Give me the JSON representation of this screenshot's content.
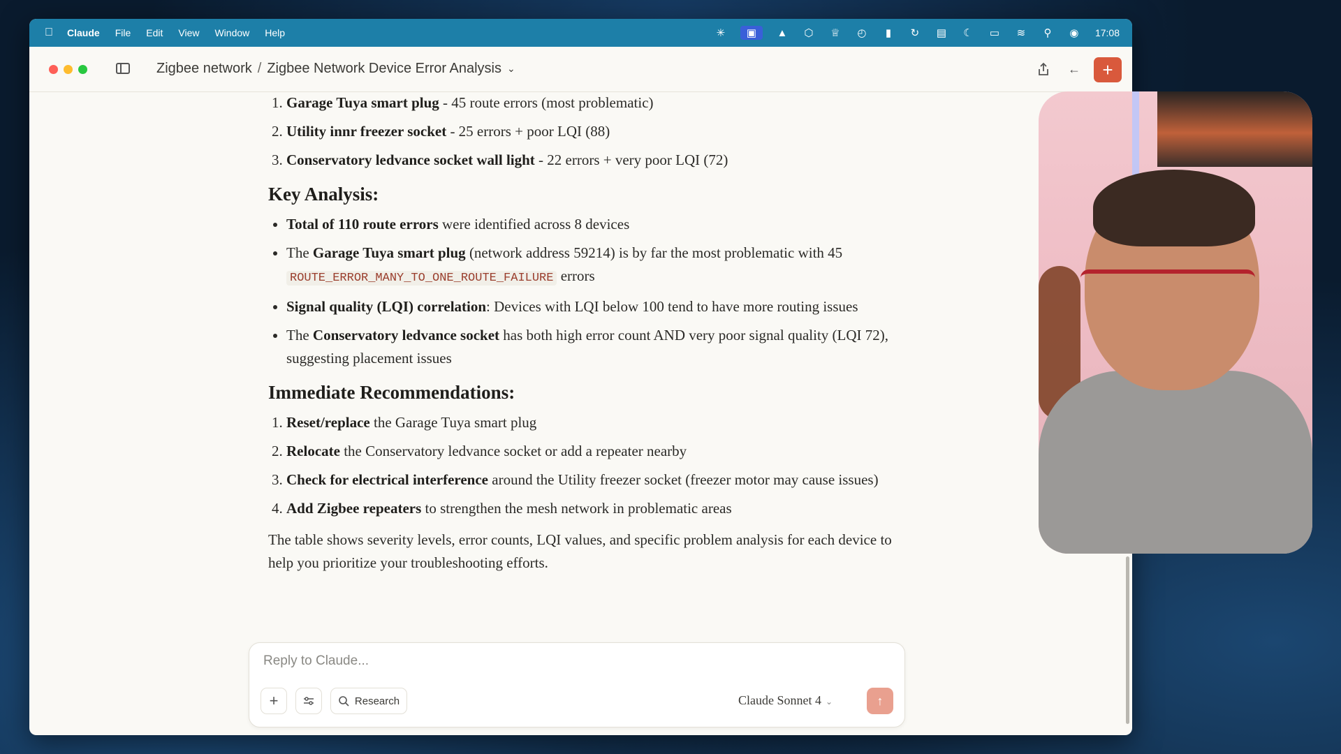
{
  "menubar": {
    "app_name": "Claude",
    "items": [
      "File",
      "Edit",
      "View",
      "Window",
      "Help"
    ],
    "clock": "17:08"
  },
  "titlebar": {
    "breadcrumb_parent": "Zigbee network",
    "breadcrumb_separator": "/",
    "breadcrumb_current": "Zigbee Network Device Error Analysis"
  },
  "content": {
    "top_list": [
      {
        "bold": "Garage Tuya smart plug",
        "rest": " - 45 route errors (most problematic)"
      },
      {
        "bold": "Utility innr freezer socket",
        "rest": " - 25 errors + poor LQI (88)"
      },
      {
        "bold": "Conservatory ledvance socket wall light",
        "rest": " - 22 errors + very poor LQI (72)"
      }
    ],
    "key_analysis_heading": "Key Analysis:",
    "key_analysis": {
      "b1_bold": "Total of 110 route errors",
      "b1_rest": " were identified across 8 devices",
      "b2_pre": "The ",
      "b2_bold": "Garage Tuya smart plug",
      "b2_mid": " (network address 59214) is by far the most problematic with 45 ",
      "b2_code": "ROUTE_ERROR_MANY_TO_ONE_ROUTE_FAILURE",
      "b2_post": " errors",
      "b3_bold": "Signal quality (LQI) correlation",
      "b3_rest": ": Devices with LQI below 100 tend to have more routing issues",
      "b4_pre": "The ",
      "b4_bold": "Conservatory ledvance socket",
      "b4_rest": " has both high error count AND very poor signal quality (LQI 72), suggesting placement issues"
    },
    "recommendations_heading": "Immediate Recommendations:",
    "recommendations": [
      {
        "bold": "Reset/replace",
        "rest": " the Garage Tuya smart plug"
      },
      {
        "bold": "Relocate",
        "rest": " the Conservatory ledvance socket or add a repeater nearby"
      },
      {
        "bold": "Check for electrical interference",
        "rest": " around the Utility freezer socket (freezer motor may cause issues)"
      },
      {
        "bold": "Add Zigbee repeaters",
        "rest": " to strengthen the mesh network in problematic areas"
      }
    ],
    "closing": "The table shows severity levels, error counts, LQI values, and specific problem analysis for each device to help you prioritize your troubleshooting efforts."
  },
  "reply": {
    "placeholder": "Reply to Claude...",
    "research_label": "Research",
    "model_label": "Claude Sonnet 4"
  },
  "colors": {
    "menubar": "#1d7fa8",
    "accent": "#d9593c",
    "window_bg": "#faf9f5"
  }
}
